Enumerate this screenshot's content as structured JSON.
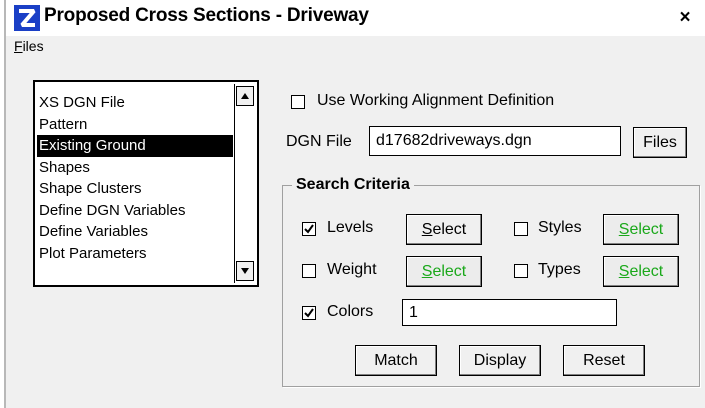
{
  "window": {
    "title": "Proposed Cross Sections - Driveway",
    "close_label": "×"
  },
  "menu": {
    "files_accel": "F",
    "files_rest": "iles"
  },
  "list": {
    "items": [
      {
        "label": "XS DGN File",
        "selected": false
      },
      {
        "label": "Pattern",
        "selected": false
      },
      {
        "label": "Existing Ground",
        "selected": true
      },
      {
        "label": "Shapes",
        "selected": false
      },
      {
        "label": "Shape Clusters",
        "selected": false
      },
      {
        "label": "Define DGN Variables",
        "selected": false
      },
      {
        "label": "Define Variables",
        "selected": false
      },
      {
        "label": "Plot Parameters",
        "selected": false
      }
    ]
  },
  "form": {
    "use_working_alignment": {
      "label": "Use Working Alignment Definition",
      "checked": false
    },
    "dgn_file": {
      "label": "DGN File",
      "value": "d17682driveways.dgn",
      "files_button": "Files"
    }
  },
  "search": {
    "title": "Search Criteria",
    "levels": {
      "label": "Levels",
      "checked": true
    },
    "styles": {
      "label": "Styles",
      "checked": false
    },
    "weight": {
      "label": "Weight",
      "checked": false
    },
    "types": {
      "label": "Types",
      "checked": false
    },
    "colors": {
      "label": "Colors",
      "checked": true,
      "value": "1"
    },
    "select_accel": "S",
    "select_rest": "elect",
    "match": "Match",
    "display": "Display",
    "reset": "Reset"
  },
  "colors": {
    "green_select_text": "#1aa81a",
    "selection_bg": "#000000"
  }
}
